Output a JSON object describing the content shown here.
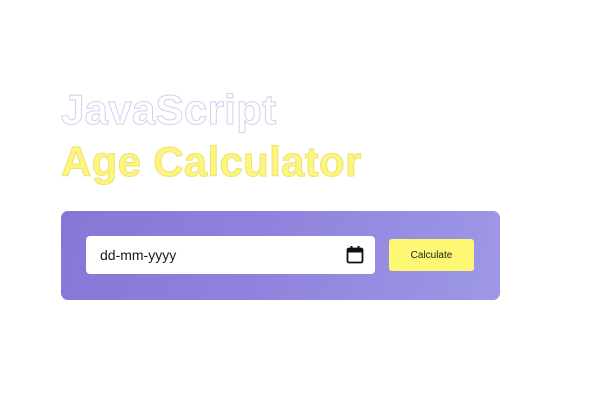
{
  "heading": {
    "line1": "JavaScript",
    "line2": "Age Calculator"
  },
  "form": {
    "date_placeholder": "dd-mm-yyyy",
    "calendar_icon": "calendar-icon",
    "calculate_label": "Calculate"
  },
  "colors": {
    "accent_yellow": "#fdf774",
    "card_gradient_start": "#8776d6",
    "card_gradient_end": "#9d98e6",
    "heading_outline": "#d6cdf3"
  }
}
